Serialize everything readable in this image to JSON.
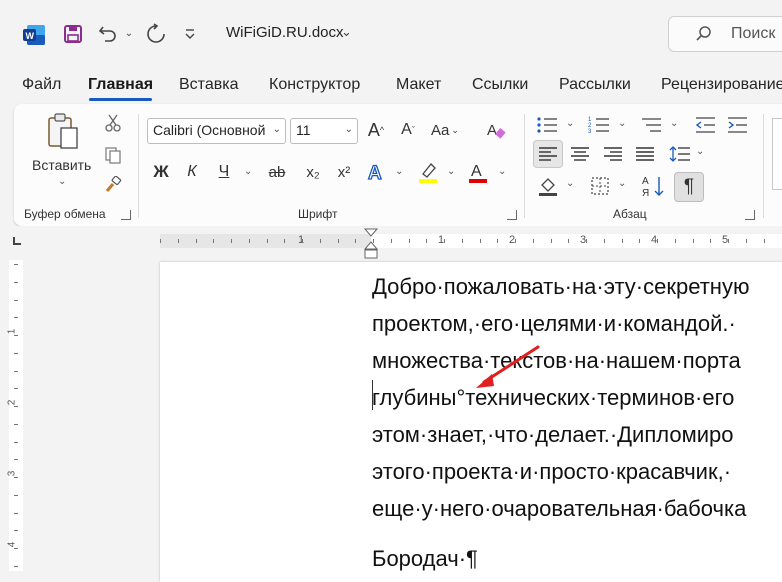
{
  "titlebar": {
    "document_title": "WiFiGiD.RU.docx",
    "search_placeholder": "Поиск",
    "icons": [
      "word-app-icon",
      "save-icon",
      "undo-icon",
      "redo-icon",
      "customize-qat-icon",
      "search-icon"
    ]
  },
  "tabs": [
    {
      "label": "Файл"
    },
    {
      "label": "Главная",
      "active": true
    },
    {
      "label": "Вставка"
    },
    {
      "label": "Конструктор"
    },
    {
      "label": "Макет"
    },
    {
      "label": "Ссылки"
    },
    {
      "label": "Рассылки"
    },
    {
      "label": "Рецензирование"
    }
  ],
  "ribbon": {
    "clipboard": {
      "group_label": "Буфер обмена",
      "paste_label": "Вставить"
    },
    "font": {
      "group_label": "Шрифт",
      "font_name": "Calibri (Основной",
      "font_size": "11",
      "bold_label": "Ж",
      "italic_label": "К",
      "underline_label": "Ч",
      "strike_label": "ab",
      "subscript_label": "x₂",
      "superscript_label": "x²",
      "grow_label": "A",
      "shrink_label": "A",
      "case_label": "Aa",
      "highlight_color": "#ffff00",
      "font_color": "#e00000"
    },
    "paragraph": {
      "group_label": "Абзац",
      "pilcrow_label": "¶"
    }
  },
  "ruler": {
    "numbers": [
      "1",
      "1",
      "2",
      "3",
      "4",
      "5"
    ],
    "vertical_numbers": [
      "1",
      "2",
      "3",
      "4"
    ]
  },
  "document": {
    "lines": [
      "Добро·пожаловать·на·эту·секретную",
      "проектом,·его·целями·и·командой.·",
      "множества·текстов·на·нашем·порта",
      "глубины°технических·терминов·его",
      "этом·знает,·что·делает.·Дипломиро",
      "этого·проекта·и·просто·красавчик,·",
      "еще·у·него·очаровательная·бабочка"
    ],
    "signature": "Бородач·¶"
  },
  "colors": {
    "accent": "#185abd",
    "annotation_arrow": "#e02020"
  }
}
